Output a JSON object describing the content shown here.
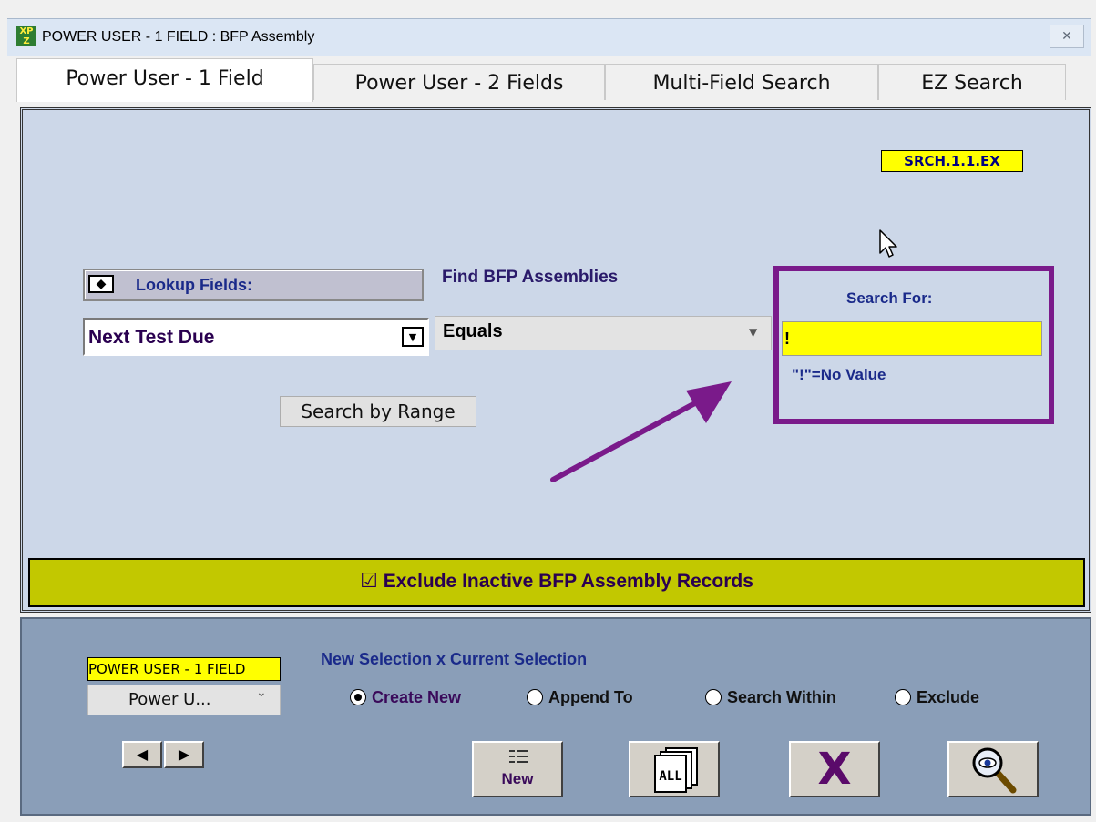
{
  "window": {
    "title": "POWER USER - 1 FIELD : BFP Assembly",
    "close_symbol": "✕",
    "icon_text": "XP\nZ"
  },
  "tabs": [
    {
      "label": "Power User - 1 Field",
      "active": true
    },
    {
      "label": "Power User - 2 Fields",
      "active": false
    },
    {
      "label": "Multi-Field Search",
      "active": false
    },
    {
      "label": "EZ Search",
      "active": false
    }
  ],
  "main": {
    "screen_code": "SRCH.1.1.EX",
    "lookup": {
      "toggle": "◆",
      "label": "Lookup Fields:"
    },
    "find_label": "Find BFP Assemblies",
    "field": {
      "value": "Next Test Due",
      "arrow": "▼"
    },
    "operator": {
      "value": "Equals",
      "arrow": "▼"
    },
    "range_button": "Search by Range",
    "search": {
      "label": "Search For:",
      "value": "!",
      "hint": "\"!\"=No Value"
    },
    "exclude": {
      "checkbox": "☑",
      "label": "Exclude Inactive BFP Assembly Records",
      "checked": true
    }
  },
  "bottom": {
    "view_label": "POWER USER - 1 FIELD",
    "view_select": "Power U...",
    "view_arrow": "⌄",
    "nav": {
      "prev": "◀",
      "next": "▶"
    },
    "selection_title": "New Selection x Current Selection",
    "radios": [
      {
        "label": "Create New",
        "selected": true
      },
      {
        "label": "Append To",
        "selected": false
      },
      {
        "label": "Search Within",
        "selected": false
      },
      {
        "label": "Exclude",
        "selected": false
      }
    ],
    "buttons": {
      "new": "New",
      "all": "ALL",
      "cancel": "X"
    }
  },
  "colors": {
    "panel": "#ccd7e8",
    "highlight_frame": "#7a1a8a",
    "exclude_bar": "#c2c800",
    "yellow": "#ffff00",
    "bottom": "#8a9eb8"
  }
}
